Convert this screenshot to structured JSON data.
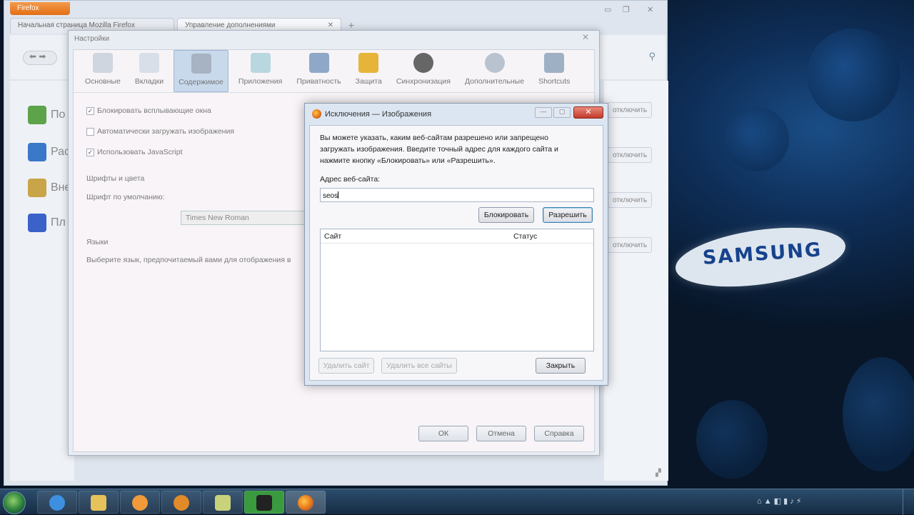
{
  "browser": {
    "menu_button": "Firefox",
    "tabs": [
      {
        "label": "Начальная страница Mozilla Firefox"
      },
      {
        "label": "Управление дополнениями"
      }
    ],
    "addons_sidebar": [
      {
        "label": "По",
        "icon": "get-addons-icon"
      },
      {
        "label": "Рас",
        "icon": "extensions-icon"
      },
      {
        "label": "Вне",
        "icon": "appearance-icon"
      },
      {
        "label": "Пл",
        "icon": "plugins-icon"
      }
    ],
    "addons_buttons": [
      "отключить",
      "отключить",
      "отключить",
      "отключить"
    ]
  },
  "preferences": {
    "title": "Настройки",
    "tabs": [
      {
        "label": "Основные",
        "icon": "general-icon"
      },
      {
        "label": "Вкладки",
        "icon": "tabs-icon"
      },
      {
        "label": "Содержимое",
        "icon": "content-icon",
        "selected": true
      },
      {
        "label": "Приложения",
        "icon": "applications-icon"
      },
      {
        "label": "Приватность",
        "icon": "privacy-icon"
      },
      {
        "label": "Защита",
        "icon": "security-icon"
      },
      {
        "label": "Синхронизация",
        "icon": "sync-icon"
      },
      {
        "label": "Дополнительные",
        "icon": "advanced-icon"
      },
      {
        "label": "Shortcuts",
        "icon": "shortcuts-icon"
      }
    ],
    "options": {
      "block_popups": "Блокировать всплывающие окна",
      "load_images": "Автоматически загружать изображения",
      "enable_js": "Использовать JavaScript"
    },
    "fonts_heading": "Шрифты и цвета",
    "default_font_label": "Шрифт по умолчанию:",
    "default_font_value": "Times New Roman",
    "languages_heading": "Языки",
    "languages_desc": "Выберите язык, предпочитаемый вами для отображения в",
    "ok": "ОК",
    "cancel": "Отмена",
    "help": "Справка"
  },
  "dialog": {
    "title": "Исключения — Изображения",
    "description": "Вы можете указать, каким веб-сайтам разрешено или запрещено загружать изображения. Введите точный адрес для каждого сайта и нажмите кнопку «Блокировать» или «Разрешить».",
    "address_label": "Адрес веб-сайта:",
    "address_value": "seos",
    "block": "Блокировать",
    "allow": "Разрешить",
    "columns": {
      "site": "Сайт",
      "status": "Статус"
    },
    "remove_site": "Удалить сайт",
    "remove_all": "Удалить все сайты",
    "close": "Закрыть"
  },
  "desktop": {
    "brand": "SAMSUNG",
    "colors": {
      "background": "#0e2e58",
      "logo": "#17428c"
    }
  },
  "taskbar": {
    "items": [
      "internet-explorer-icon",
      "explorer-folder-icon",
      "media-player-icon",
      "headphones-app-icon",
      "notepad-icon",
      "video-app-icon",
      "firefox-icon"
    ]
  }
}
